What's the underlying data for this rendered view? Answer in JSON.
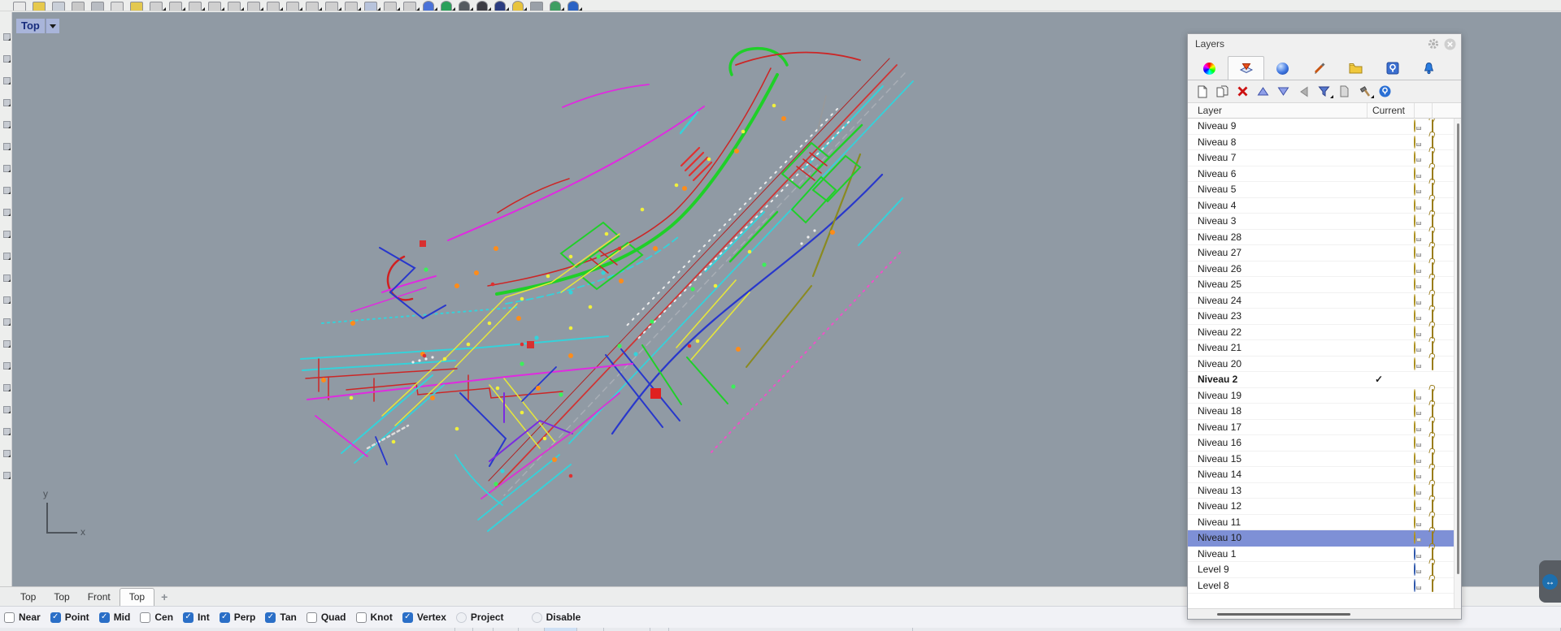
{
  "viewport": {
    "label": "Top",
    "axis": {
      "x_label": "x",
      "y_label": "y"
    },
    "background_color": "#909aa4"
  },
  "top_toolbar": {
    "icons": [
      {
        "name": "new-file-icon",
        "color": "#e9e9e9"
      },
      {
        "name": "open-file-icon",
        "color": "#e6c94c"
      },
      {
        "name": "save-icon",
        "color": "#c9cfd8"
      },
      {
        "name": "print-icon",
        "color": "#c8c8c8"
      },
      {
        "name": "cut-icon",
        "color": "#b8bcc2"
      },
      {
        "name": "copy-icon",
        "color": "#dcdcdc"
      },
      {
        "name": "paste-icon",
        "color": "#e3c84f"
      },
      {
        "name": "undo-icon",
        "color": "#d0d0d0",
        "caret": true
      },
      {
        "name": "redo-icon",
        "color": "#d0d0d0",
        "caret": true
      },
      {
        "name": "select-icon",
        "color": "#cfcfcf",
        "caret": true
      },
      {
        "name": "lasso-icon",
        "color": "#cfcfcf",
        "caret": true
      },
      {
        "name": "hide-icon",
        "color": "#cfcfcf",
        "caret": true
      },
      {
        "name": "move-icon",
        "color": "#cfcfcf",
        "caret": true
      },
      {
        "name": "rotate-icon",
        "color": "#cfcfcf",
        "caret": true
      },
      {
        "name": "scale-icon",
        "color": "#cfcfcf",
        "caret": true
      },
      {
        "name": "mirror-icon",
        "color": "#cfcfcf",
        "caret": true
      },
      {
        "name": "join-icon",
        "color": "#cfcfcf",
        "caret": true
      },
      {
        "name": "trim-icon",
        "color": "#cfcfcf",
        "caret": true
      },
      {
        "name": "viewport-layout-icon",
        "color": "#b8c4dc",
        "caret": true
      },
      {
        "name": "pan-icon",
        "color": "#cfcfcf",
        "caret": true
      },
      {
        "name": "zoom-icon",
        "color": "#cfcfcf",
        "caret": true
      },
      {
        "name": "shaded-view-icon",
        "color": "#4a72d8",
        "caret": true,
        "round": true
      },
      {
        "name": "rendered-view-icon",
        "color": "#2aa05a",
        "caret": true,
        "round": true
      },
      {
        "name": "ghosted-view-icon",
        "color": "#555a60",
        "caret": true,
        "round": true
      },
      {
        "name": "xray-view-icon",
        "color": "#3c3c44",
        "caret": true,
        "round": true
      },
      {
        "name": "render-icon",
        "color": "#2a3c80",
        "caret": true,
        "round": true
      },
      {
        "name": "sun-icon",
        "color": "#e8c43c",
        "caret": true,
        "round": true
      },
      {
        "name": "measure-icon",
        "color": "#9aa0a8"
      },
      {
        "name": "earth-icon",
        "color": "#3f9e62",
        "caret": true,
        "round": true
      },
      {
        "name": "globe-icon",
        "color": "#2b62c4",
        "caret": true,
        "round": true
      }
    ]
  },
  "left_toolbar": {
    "icons_visible": 21
  },
  "layers_panel": {
    "title": "Layers",
    "titlebar_icons": [
      "gear-icon",
      "close-icon"
    ],
    "tabs": [
      "properties",
      "layers",
      "display",
      "pen",
      "folder",
      "help",
      "notifications"
    ],
    "active_tab": "layers",
    "toolbar_icons": [
      "new-layer",
      "duplicate-layer",
      "delete-layer",
      "move-layer-up",
      "move-layer-down",
      "collapse",
      "filter",
      "match-layer",
      "layer-tools",
      "help"
    ],
    "columns": {
      "layer": "Layer",
      "current": "Current"
    },
    "current_mark": "✓",
    "rows": [
      {
        "name": "Niveau 9"
      },
      {
        "name": "Niveau 8"
      },
      {
        "name": "Niveau 7"
      },
      {
        "name": "Niveau 6"
      },
      {
        "name": "Niveau 5"
      },
      {
        "name": "Niveau 4"
      },
      {
        "name": "Niveau 3"
      },
      {
        "name": "Niveau 28"
      },
      {
        "name": "Niveau 27"
      },
      {
        "name": "Niveau 26"
      },
      {
        "name": "Niveau 25"
      },
      {
        "name": "Niveau 24"
      },
      {
        "name": "Niveau 23"
      },
      {
        "name": "Niveau 22"
      },
      {
        "name": "Niveau 21"
      },
      {
        "name": "Niveau 20"
      },
      {
        "name": "Niveau 2",
        "current": true,
        "bold": true,
        "hide_icons": true
      },
      {
        "name": "Niveau 19"
      },
      {
        "name": "Niveau 18"
      },
      {
        "name": "Niveau 17"
      },
      {
        "name": "Niveau 16"
      },
      {
        "name": "Niveau 15"
      },
      {
        "name": "Niveau 14"
      },
      {
        "name": "Niveau 13"
      },
      {
        "name": "Niveau 12"
      },
      {
        "name": "Niveau 11"
      },
      {
        "name": "Niveau 10",
        "selected": true
      },
      {
        "name": "Niveau 1",
        "bulb": "off"
      },
      {
        "name": "Level 9",
        "bulb": "off"
      },
      {
        "name": "Level 8",
        "bulb": "off"
      }
    ],
    "selection_color": "#7e90d6"
  },
  "viewport_tabs": {
    "tabs": [
      {
        "label": "Top"
      },
      {
        "label": "Top"
      },
      {
        "label": "Front"
      },
      {
        "label": "Top",
        "active": true
      }
    ],
    "add_label": "+"
  },
  "osnap": {
    "items": [
      {
        "label": "Near",
        "checked": false
      },
      {
        "label": "Point",
        "checked": true
      },
      {
        "label": "Mid",
        "checked": true
      },
      {
        "label": "Cen",
        "checked": false
      },
      {
        "label": "Int",
        "checked": true
      },
      {
        "label": "Perp",
        "checked": true
      },
      {
        "label": "Tan",
        "checked": true
      },
      {
        "label": "Quad",
        "checked": false
      },
      {
        "label": "Knot",
        "checked": false
      },
      {
        "label": "Vertex",
        "checked": true
      },
      {
        "label": "Project",
        "checked": false,
        "disabled": true
      },
      {
        "label": "Disable",
        "checked": false,
        "disabled": true,
        "gap_before": true
      }
    ],
    "checked_color": "#2b6fc7"
  },
  "overlay": {
    "teamviewer_icon": "↔"
  },
  "drawing": {
    "description": "2D CAD street plan viewed from Top",
    "palette": {
      "magenta": "#e02ae0",
      "green": "#1fd028",
      "red": "#cc2626",
      "cyan": "#35d2da",
      "yellow": "#e6e63a",
      "blue": "#2837cc",
      "purple": "#7a2be0",
      "olive": "#8a8a20",
      "pink": "#f050c8",
      "orange": "#ff8c1a",
      "white": "#eeeeee",
      "gray": "#aab0b8"
    }
  }
}
